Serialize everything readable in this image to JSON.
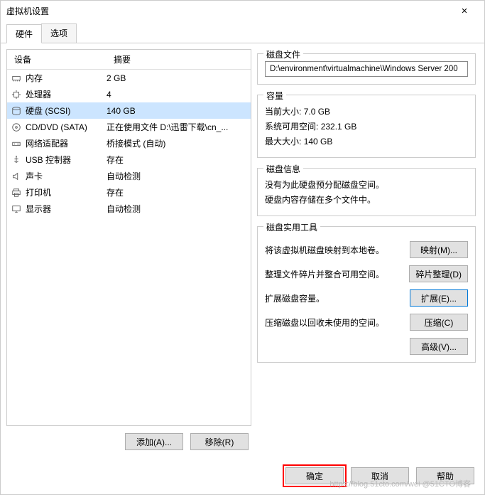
{
  "window": {
    "title": "虚拟机设置",
    "close": "×"
  },
  "tabs": {
    "hardware": "硬件",
    "options": "选项"
  },
  "list": {
    "header_device": "设备",
    "header_summary": "摘要",
    "rows": [
      {
        "icon": "memory-icon",
        "device": "内存",
        "summary": "2 GB"
      },
      {
        "icon": "cpu-icon",
        "device": "处理器",
        "summary": "4"
      },
      {
        "icon": "disk-icon",
        "device": "硬盘 (SCSI)",
        "summary": "140 GB",
        "selected": true
      },
      {
        "icon": "cd-icon",
        "device": "CD/DVD (SATA)",
        "summary": "正在使用文件 D:\\迅雷下载\\cn_..."
      },
      {
        "icon": "network-icon",
        "device": "网络适配器",
        "summary": "桥接模式 (自动)"
      },
      {
        "icon": "usb-icon",
        "device": "USB 控制器",
        "summary": "存在"
      },
      {
        "icon": "sound-icon",
        "device": "声卡",
        "summary": "自动检测"
      },
      {
        "icon": "printer-icon",
        "device": "打印机",
        "summary": "存在"
      },
      {
        "icon": "display-icon",
        "device": "显示器",
        "summary": "自动检测"
      }
    ]
  },
  "left_buttons": {
    "add": "添加(A)...",
    "remove": "移除(R)"
  },
  "disk_file": {
    "title": "磁盘文件",
    "path": "D:\\environment\\virtualmachine\\Windows Server 200"
  },
  "capacity": {
    "title": "容量",
    "current_label": "当前大小:",
    "current_value": "7.0 GB",
    "free_label": "系统可用空间:",
    "free_value": "232.1 GB",
    "max_label": "最大大小:",
    "max_value": "140 GB"
  },
  "disk_info": {
    "title": "磁盘信息",
    "line1": "没有为此硬盘预分配磁盘空间。",
    "line2": "硬盘内容存储在多个文件中。"
  },
  "tools": {
    "title": "磁盘实用工具",
    "map_desc": "将该虚拟机磁盘映射到本地卷。",
    "map_btn": "映射(M)...",
    "defrag_desc": "整理文件碎片并整合可用空间。",
    "defrag_btn": "碎片整理(D)",
    "expand_desc": "扩展磁盘容量。",
    "expand_btn": "扩展(E)...",
    "compact_desc": "压缩磁盘以回收未使用的空间。",
    "compact_btn": "压缩(C)",
    "advanced_btn": "高级(V)..."
  },
  "footer": {
    "ok": "确定",
    "cancel": "取消",
    "help": "帮助"
  },
  "watermark": "https://blog.51cto.com/wei @51CTO博客"
}
